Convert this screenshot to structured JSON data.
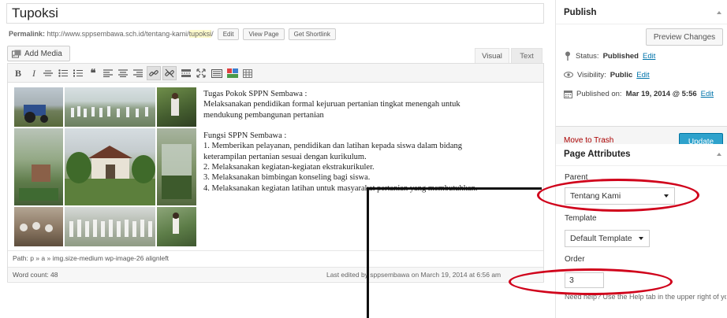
{
  "post": {
    "title": "Tupoksi",
    "permalink_label": "Permalink:",
    "permalink_base": "http://www.sppsembawa.sch.id/tentang-kami/",
    "permalink_slug": "tupoksi",
    "permalink_trailing": "/",
    "edit_label": "Edit",
    "view_page_label": "View Page",
    "shortlink_label": "Get Shortlink"
  },
  "editor": {
    "add_media_label": "Add Media",
    "tab_visual": "Visual",
    "tab_text": "Text",
    "toolbar": {
      "bold": "B",
      "italic": "I",
      "icons": [
        "strikethrough-icon",
        "bullet-list-icon",
        "numbered-list-icon",
        "blockquote-icon",
        "align-left-icon",
        "align-center-icon",
        "align-right-icon",
        "insert-link-icon",
        "remove-link-icon",
        "read-more-icon",
        "fullscreen-icon",
        "toolbar-toggle-icon",
        "media-icon",
        "table-icon"
      ]
    },
    "content": {
      "heading1": "Tugas Pokok SPPN Sembawa :",
      "para1_line1": "Melaksanakan pendidikan formal kejuruan pertanian tingkat menengah untuk",
      "para1_line2": "mendukung pembangunan pertanian",
      "heading2": "Fungsi SPPN Sembawa :",
      "item1_line1": "1. Memberikan pelayanan, pendidikan dan latihan kepada siswa dalam bidang",
      "item1_line2": "keterampilan pertanian sesuai dengan kurikulum.",
      "item2": "2. Melaksanakan kegiatan-kegiatan ekstrakurikuler.",
      "item3": "3. Melaksanakan bimbingan konseling bagi siswa.",
      "item4": "4. Melaksanakan kegiatan latihan untuk masyarakat pertanian yang membutuhkan."
    },
    "path": "Path: p » a » img.size-medium wp-image-26 alignleft",
    "word_count": "Word count: 48",
    "last_edited": "Last edited by sppsembawa on March 19, 2014 at 6:56 am"
  },
  "publish": {
    "heading": "Publish",
    "preview_label": "Preview Changes",
    "status_label": "Status:",
    "status_value": "Published",
    "visibility_label": "Visibility:",
    "visibility_value": "Public",
    "published_on_label": "Published on:",
    "published_on_value": "Mar 19, 2014 @ 5:56",
    "edit_link": "Edit",
    "trash_label": "Move to Trash",
    "update_label": "Update"
  },
  "page_attributes": {
    "heading": "Page Attributes",
    "parent_label": "Parent",
    "parent_value": "Tentang Kami",
    "template_label": "Template",
    "template_value": "Default Template",
    "order_label": "Order",
    "order_value": "3",
    "help_text": "Need help? Use the Help tab in the upper right of your screen."
  },
  "colors": {
    "link": "#0073aa",
    "update_button": "#2ea2cc",
    "trash": "#aa0000",
    "annotation_red": "#d0021b"
  }
}
